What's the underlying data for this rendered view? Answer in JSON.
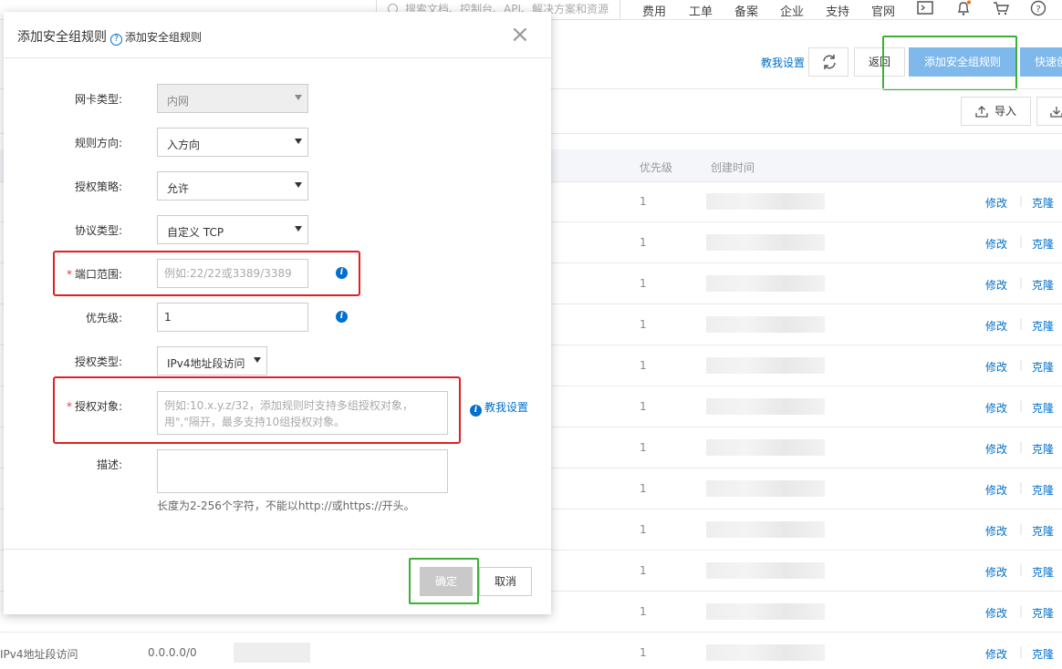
{
  "topnav": {
    "search_placeholder": "搜索文档、控制台、API、解决方案和资源",
    "items": [
      "费用",
      "工单",
      "备案",
      "企业",
      "支持",
      "官网"
    ]
  },
  "toolbar": {
    "setup_link": "教我设置",
    "back_label": "返回",
    "add_rule_label": "添加安全组规则",
    "quick_label": "快速创",
    "import_label": "导入"
  },
  "table": {
    "headers": {
      "priority": "优先级",
      "created": "创建时间"
    },
    "priority_value": "1",
    "edit_label": "修改",
    "clone_label": "克隆",
    "last_row_auth": "IPv4地址段访问",
    "last_row_ip": "0.0.0.0/0"
  },
  "modal": {
    "title": "添加安全组规则",
    "help_text": "添加安全组规则",
    "close": "×",
    "fields": {
      "nic_type": {
        "label": "网卡类型:",
        "value": "内网"
      },
      "direction": {
        "label": "规则方向:",
        "value": "入方向"
      },
      "policy": {
        "label": "授权策略:",
        "value": "允许"
      },
      "protocol": {
        "label": "协议类型:",
        "value": "自定义 TCP"
      },
      "port_range": {
        "label": "端口范围:",
        "placeholder": "例如:22/22或3389/3389"
      },
      "priority": {
        "label": "优先级:",
        "value": "1"
      },
      "auth_type": {
        "label": "授权类型:",
        "value": "IPv4地址段访问"
      },
      "auth_object": {
        "label": "授权对象:",
        "placeholder": "例如:10.x.y.z/32，添加规则时支持多组授权对象，用\",\"隔开，最多支持10组授权对象。"
      },
      "description": {
        "label": "描述:",
        "hint": "长度为2-256个字符，不能以http://或https://开头。"
      }
    },
    "teach_link": "教我设置",
    "ok_label": "确定",
    "cancel_label": "取消"
  },
  "colors": {
    "link": "#0070cc",
    "primary_disabled": "#7fb9eb",
    "highlight_red": "#e02020",
    "highlight_green": "#3cb034"
  }
}
